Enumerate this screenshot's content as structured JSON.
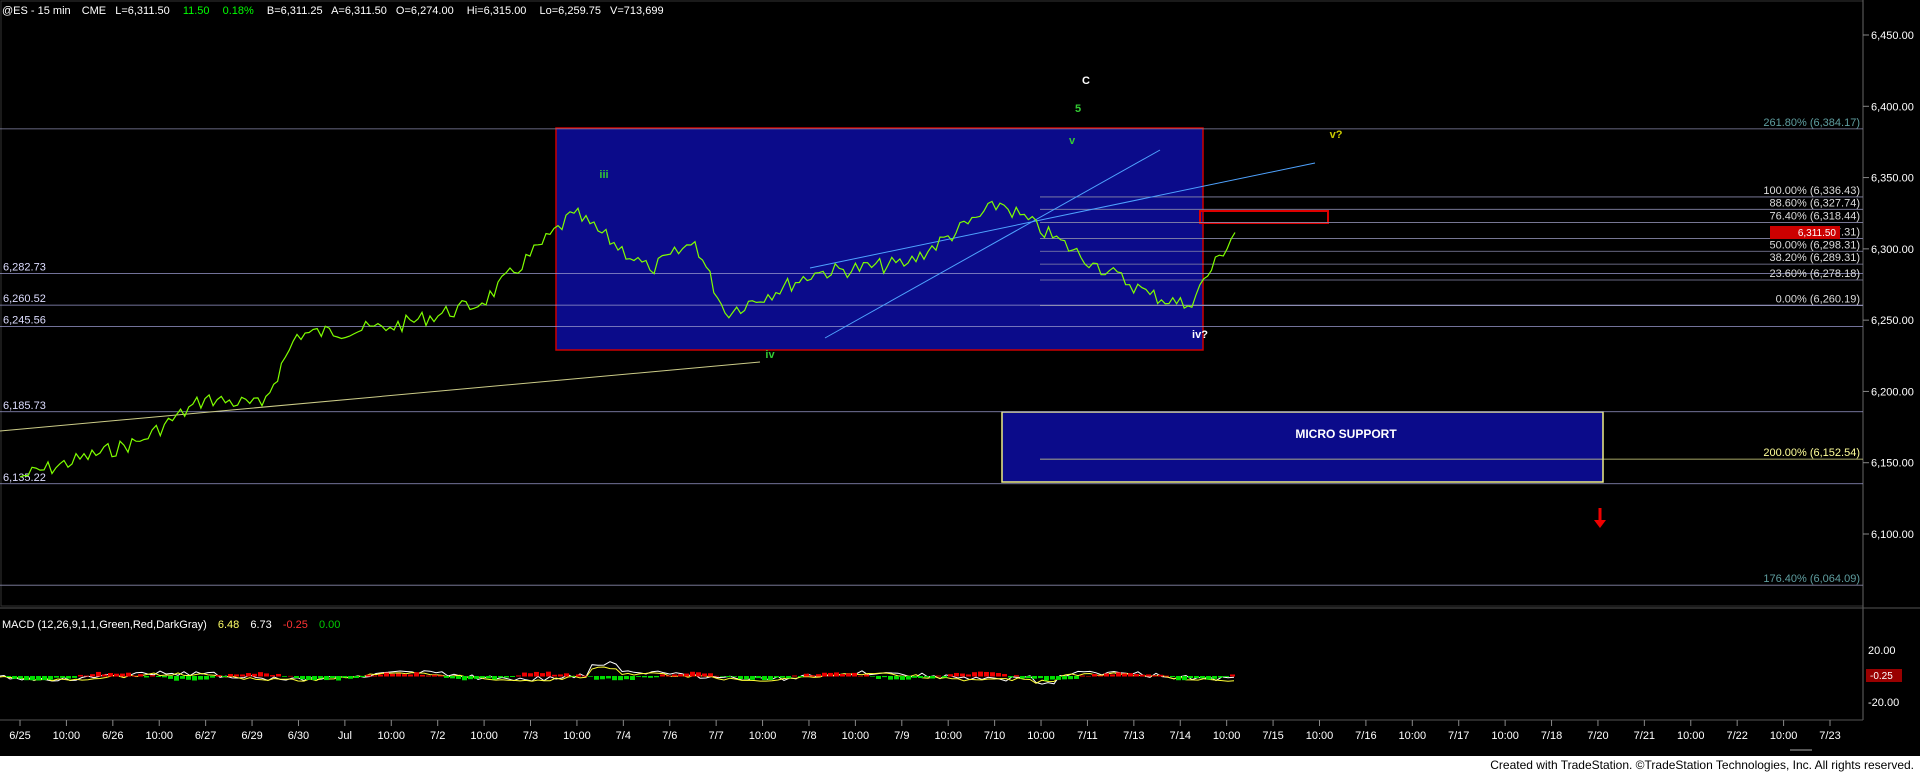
{
  "header": {
    "symbol": "@ES - 15 min",
    "exchange": "CME",
    "last": "L=6,311.50",
    "change": "11.50",
    "change_pct": "0.18%",
    "bid": "B=6,311.25",
    "ask": "A=6,311.50",
    "open": "O=6,274.00",
    "high": "Hi=6,315.00",
    "low": "Lo=6,259.75",
    "volume": "V=713,699"
  },
  "footer": {
    "text": "Created with TradeStation. ©TradeStation Technologies, Inc. All rights reserved."
  },
  "chart_data": {
    "type": "line",
    "title": "@ES - 15 min",
    "ylim": [
      6020,
      6470
    ],
    "y_ticks": [
      "6,450.00",
      "6,400.00",
      "6,350.00",
      "6,300.00",
      "6,250.00",
      "6,200.00",
      "6,150.00",
      "6,100.00"
    ],
    "y_tick_values": [
      6450,
      6400,
      6350,
      6300,
      6250,
      6200,
      6150,
      6100
    ],
    "last_price_tag": "6,311.50",
    "x_ticks": [
      "6/25",
      "10:00",
      "6/26",
      "10:00",
      "6/27",
      "6/29",
      "6/30",
      "Jul",
      "10:00",
      "7/2",
      "10:00",
      "7/3",
      "10:00",
      "7/4",
      "7/6",
      "7/7",
      "10:00",
      "7/8",
      "10:00",
      "7/9",
      "10:00",
      "7/10",
      "10:00",
      "7/11",
      "7/13",
      "7/14",
      "10:00",
      "7/15",
      "10:00",
      "7/16",
      "10:00",
      "7/17",
      "10:00",
      "7/18",
      "7/20",
      "7/21",
      "10:00",
      "7/22",
      "10:00",
      "7/23"
    ],
    "series": [
      {
        "name": "@ES",
        "color": "#7fff00",
        "x": [
          "6/25",
          "6/26",
          "6/27",
          "6/29",
          "6/30",
          "Jul",
          "7/2",
          "7/3",
          "7/4",
          "7/6",
          "7/7",
          "7/8",
          "7/9",
          "7/10",
          "7/11",
          "7/13",
          "7/14",
          "7/14 10:00"
        ],
        "values": [
          6140,
          6165,
          6195,
          6190,
          6240,
          6245,
          6262,
          6325,
          6285,
          6305,
          6255,
          6283,
          6290,
          6332,
          6290,
          6268,
          6260,
          6311.5
        ]
      }
    ],
    "left_levels": [
      {
        "label": "6,282.73",
        "value": 6282.73
      },
      {
        "label": "6,260.52",
        "value": 6260.52
      },
      {
        "label": "6,245.56",
        "value": 6245.56
      },
      {
        "label": "6,185.73",
        "value": 6185.73
      },
      {
        "label": "6,135.22",
        "value": 6135.22
      }
    ],
    "fib_levels": [
      {
        "label": "261.80% (6,384.17)",
        "value": 6384.17
      },
      {
        "label": "100.00% (6,336.43)",
        "value": 6336.43
      },
      {
        "label": "88.60% (6,327.74)",
        "value": 6327.74
      },
      {
        "label": "76.40% (6,318.44)",
        "value": 6318.44
      },
      {
        "label": "61.80% (6,307.31)",
        "value": 6307.31
      },
      {
        "label": "50.00% (6,298.31)",
        "value": 6298.31
      },
      {
        "label": "38.20% (6,289.31)",
        "value": 6289.31
      },
      {
        "label": "23.60% (6,278.18)",
        "value": 6278.18
      },
      {
        "label": "0.00% (6,260.19)",
        "value": 6260.19
      },
      {
        "label": "200.00% (6,152.54)",
        "value": 6152.54
      },
      {
        "label": "176.40% (6,064.09)",
        "value": 6064.09
      }
    ],
    "wave_labels": [
      {
        "text": "iii",
        "color": "#33cc33"
      },
      {
        "text": "iv",
        "color": "#33cc33"
      },
      {
        "text": "C",
        "color": "#ffffff"
      },
      {
        "text": "5",
        "color": "#33cc33"
      },
      {
        "text": "v",
        "color": "#33cc33"
      },
      {
        "text": "v?",
        "color": "#cccc00"
      },
      {
        "text": "iv?",
        "color": "#ffffff"
      }
    ],
    "annotations": [
      {
        "text": "MICRO SUPPORT"
      }
    ],
    "macd": {
      "label": "MACD (12,26,9,1,1,Green,Red,DarkGray)",
      "values": [
        "6.48",
        "6.73",
        "-0.25",
        "0.00"
      ],
      "y_ticks": [
        "20.00",
        "-20.00"
      ],
      "tag": "-0.25"
    }
  }
}
